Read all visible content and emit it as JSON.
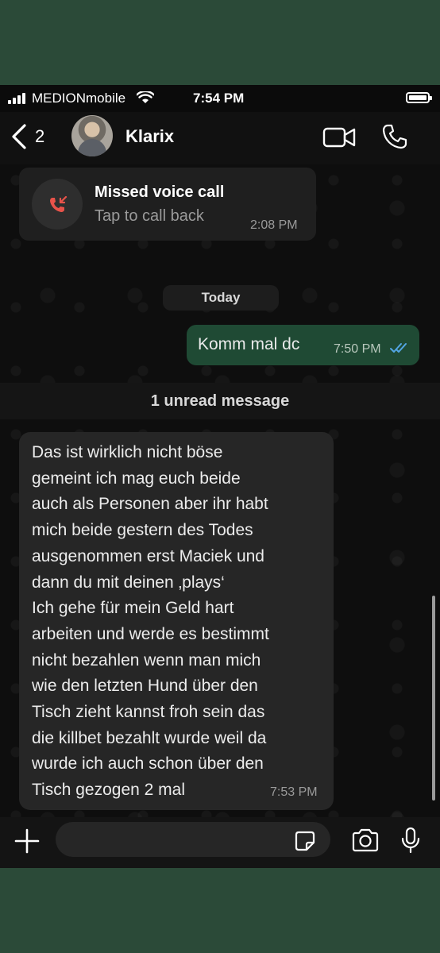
{
  "status_bar": {
    "carrier": "MEDIONmobile",
    "time": "7:54 PM"
  },
  "header": {
    "back_count": "2",
    "contact_name": "Klarix",
    "icons": [
      "chevron-left-icon",
      "video-camera-icon",
      "phone-icon"
    ]
  },
  "messages": {
    "missed_call": {
      "title": "Missed voice call",
      "subtitle": "Tap to call back",
      "time": "2:08 PM"
    },
    "day_separator": "Today",
    "outgoing": {
      "text": "Komm mal dc",
      "time": "7:50 PM",
      "status": "read"
    },
    "unread_divider": "1 unread message",
    "incoming": {
      "text": "Das ist wirklich nicht böse\ngemeint ich mag euch beide\nauch als Personen aber ihr habt\nmich beide gestern des Todes\nausgenommen erst Maciek und\ndann du mit deinen ‚plays‘\nIch gehe für mein Geld hart\narbeiten und werde es bestimmt\nnicht bezahlen wenn man mich\nwie den letzten Hund über den\nTisch zieht kannst froh sein das\ndie killbet bezahlt wurde weil da\nwurde ich auch schon über den\nTisch gezogen 2 mal",
      "time": "7:53 PM"
    }
  },
  "composer": {
    "placeholder": "",
    "icons": [
      "plus-icon",
      "sticker-icon",
      "camera-icon",
      "microphone-icon"
    ]
  },
  "colors": {
    "outer_background": "#2b4a38",
    "outgoing_bubble": "#1f4a34",
    "incoming_bubble": "#262626",
    "read_ticks": "#53a6e4",
    "missed_call_red": "#e8534a"
  }
}
